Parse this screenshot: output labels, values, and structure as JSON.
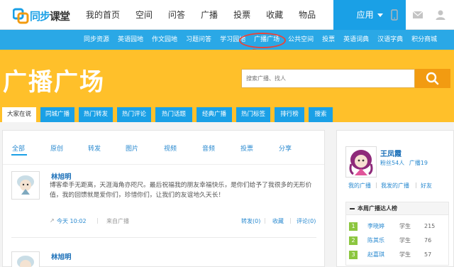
{
  "logo": {
    "main": "同步",
    "sub": "课堂"
  },
  "nav": {
    "items": [
      "我的首页",
      "空间",
      "问答",
      "广播",
      "投票",
      "收藏",
      "物品"
    ],
    "app_label": "应用"
  },
  "subnav": {
    "items": [
      "同步资源",
      "英语园地",
      "作文园地",
      "习题问答",
      "学习园地",
      "广播广场",
      "公共空间",
      "投票",
      "英语词典",
      "汉语字典",
      "积分商城"
    ],
    "active_index": 5
  },
  "banner": {
    "title": "广播广场",
    "search_placeholder": "搜索广播、找人"
  },
  "tabs": [
    "大家在说",
    "同城广播",
    "热门转发",
    "热门评论",
    "热门话题",
    "经典广播",
    "热门标签",
    "排行榜",
    "搜索"
  ],
  "filters": [
    "全部",
    "原创",
    "转发",
    "图片",
    "视频",
    "音频",
    "投票",
    "分享"
  ],
  "posts": [
    {
      "author": "林旭明",
      "text": "博客牵手无距离，天涯海角亦咫尺。最后祝福我的朋友幸福快乐，是你们给予了我很多的无形价值，我的回馈就是爱你们，珍惜你们，让我们的友谊地久天长！",
      "time": "今天 10:02",
      "source": "来自广播",
      "forward": "转发(0)",
      "collect": "收藏",
      "comment": "评论(0)"
    },
    {
      "author": "林旭明"
    }
  ],
  "sidebar": {
    "name": "王凤霞",
    "fans": "粉丝54人",
    "broadcasts": "广播19",
    "links": [
      "我的广播",
      "我发的广播",
      "好友"
    ],
    "rank_title": "本周广播达人榜",
    "rank": [
      {
        "num": "1",
        "name": "李晓婷",
        "role": "学生",
        "count": "215"
      },
      {
        "num": "2",
        "name": "陈其乐",
        "role": "学生",
        "count": "76"
      },
      {
        "num": "3",
        "name": "赵嘉琪",
        "role": "学生",
        "count": "57"
      }
    ]
  },
  "colors": {
    "accent_blue": "#1aa0e6",
    "banner_yellow": "#ffc02a",
    "search_orange": "#f29b11",
    "highlight_red": "#e8443a"
  }
}
